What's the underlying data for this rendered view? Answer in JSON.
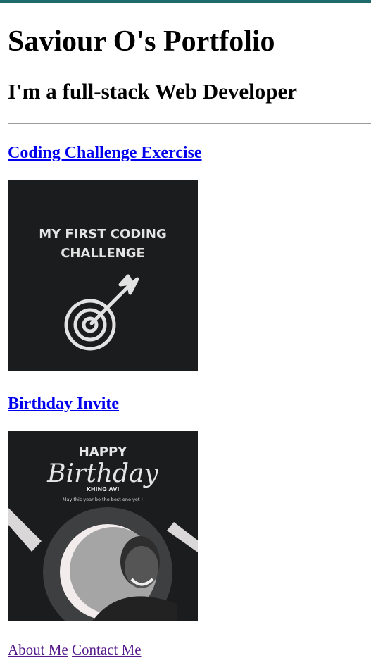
{
  "header": {
    "title": "Saviour O's Portfolio",
    "subtitle": "I'm a full-stack Web Developer"
  },
  "projects": [
    {
      "link_text": "Coding Challenge Exercise",
      "image": {
        "icon": "target-arrow-icon",
        "line1": "MY FIRST CODING",
        "line2": "CHALLENGE"
      }
    },
    {
      "link_text": "Birthday Invite",
      "image": {
        "happy": "HAPPY",
        "birthday": "Birthday",
        "name": "KHING AVI",
        "tagline": "May this year be the best one yet !"
      }
    }
  ],
  "nav": {
    "about": "About Me",
    "contact": "Contact Me"
  },
  "colors": {
    "top_bar": "#1f6b6b",
    "link": "#0000ee",
    "visited_link": "#551a8b",
    "thumb_bg": "#1b1c1e"
  }
}
